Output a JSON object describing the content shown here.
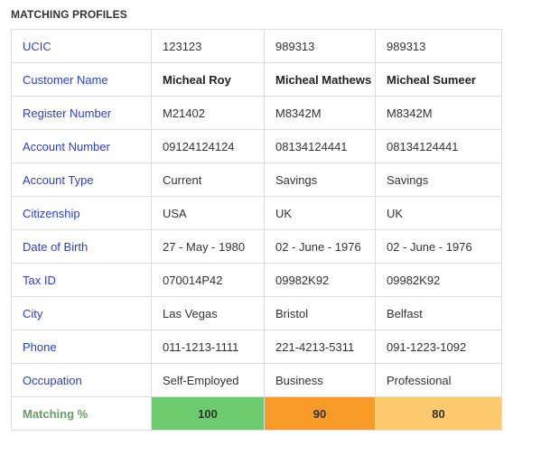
{
  "section_title": "MATCHING PROFILES",
  "rows": [
    {
      "label": "UCIC",
      "values": [
        "123123",
        "989313",
        "989313"
      ]
    },
    {
      "label": "Customer Name",
      "values": [
        "Micheal Roy",
        "Micheal Mathews",
        "Micheal Sumeer"
      ]
    },
    {
      "label": "Register Number",
      "values": [
        "M21402",
        "M8342M",
        "M8342M"
      ]
    },
    {
      "label": "Account Number",
      "values": [
        "09124124124",
        "08134124441",
        "08134124441"
      ]
    },
    {
      "label": "Account Type",
      "values": [
        "Current",
        "Savings",
        "Savings"
      ]
    },
    {
      "label": "Citizenship",
      "values": [
        "USA",
        "UK",
        "UK"
      ]
    },
    {
      "label": "Date of Birth",
      "values": [
        "27 - May - 1980",
        "02 - June - 1976",
        "02 - June - 1976"
      ]
    },
    {
      "label": "Tax ID",
      "values": [
        "070014P42",
        "09982K92",
        "09982K92"
      ]
    },
    {
      "label": "City",
      "values": [
        "Las Vegas",
        "Bristol",
        "Belfast"
      ]
    },
    {
      "label": "Phone",
      "values": [
        "011-1213-1111",
        "221-4213-5311",
        "091-1223-1092"
      ]
    },
    {
      "label": "Occupation",
      "values": [
        "Self-Employed",
        "Business",
        "Professional"
      ]
    }
  ],
  "matching": {
    "label": "Matching %",
    "values": [
      "100",
      "90",
      "80"
    ],
    "colors": [
      "#6ccb6c",
      "#f99b28",
      "#fdcb6e"
    ]
  },
  "colors": {
    "label_blue": "#2a3fd0",
    "matching_label_green": "#6b9a6b",
    "border": "#dddddd"
  }
}
